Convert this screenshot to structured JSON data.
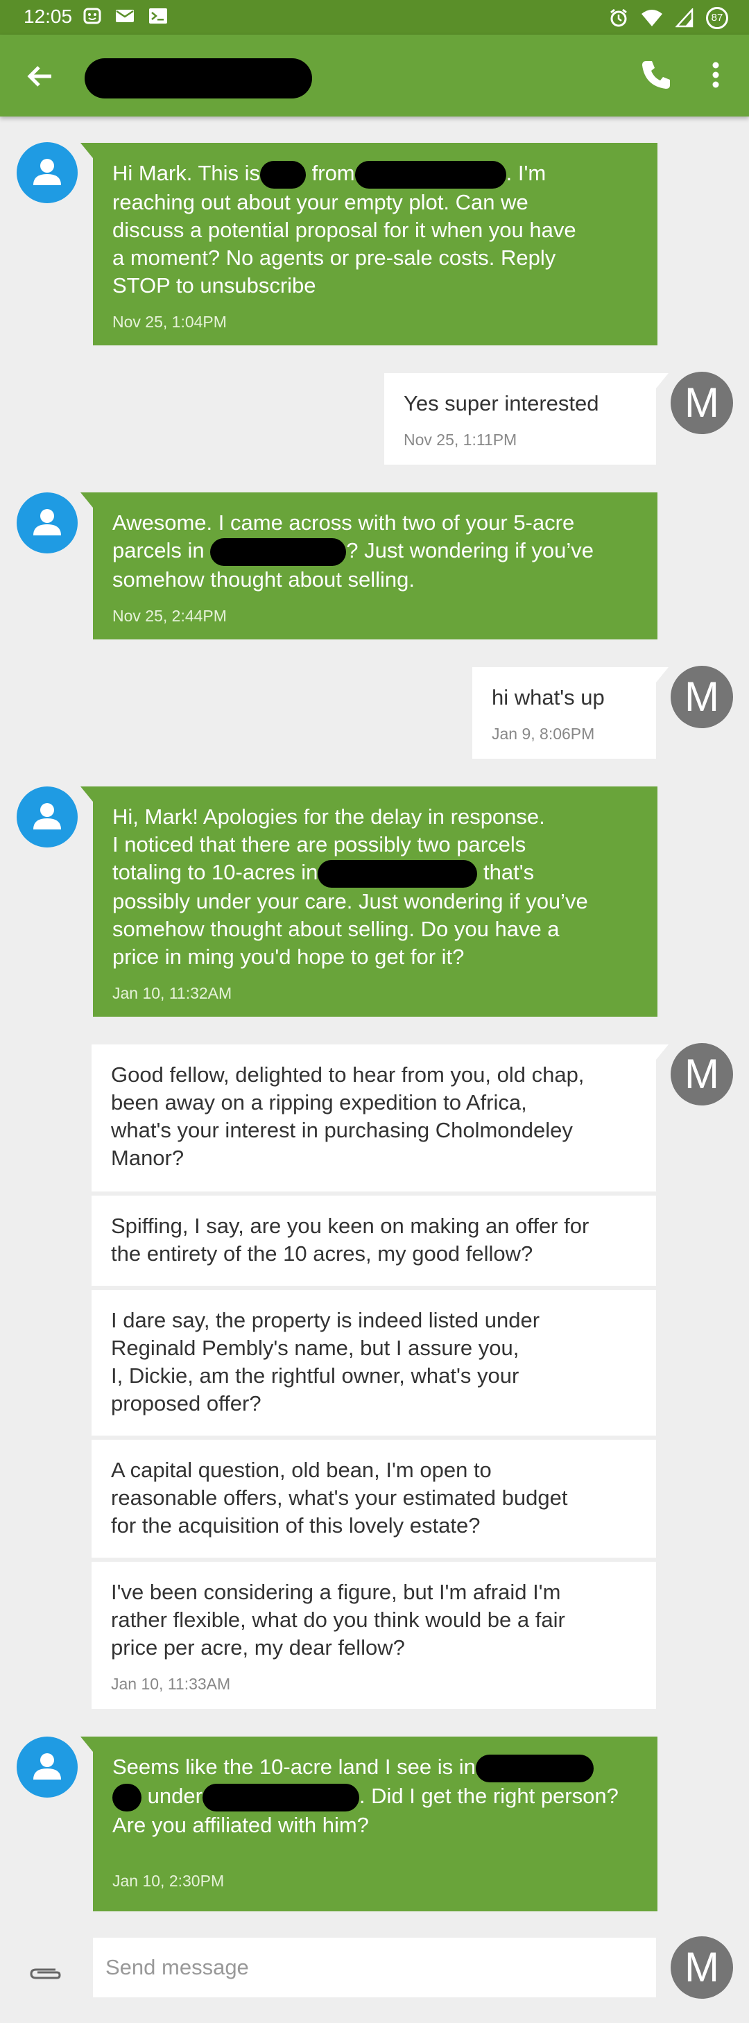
{
  "status_bar": {
    "time": "12:05",
    "battery": "87"
  },
  "app_bar": {
    "back_icon": "arrow-left-icon",
    "call_icon": "phone-icon",
    "menu_icon": "more-vert-icon"
  },
  "messages": [
    {
      "text": "Hi Mark. This is",
      "text2": " from",
      "text3": ". I'm\nreaching out about your empty plot. Can we\ndiscuss a potential proposal for it when you have\na moment? No agents or pre-sale costs.         Reply\nSTOP to unsubscribe",
      "time": "Nov 25, 1:04PM"
    },
    {
      "text": "Yes super interested",
      "time": "Nov 25, 1:11PM"
    },
    {
      "text": "Awesome. I came across with two of your 5-acre\nparcels in ",
      "text2": "? Just wondering if you’ve\nsomehow thought about selling.",
      "time": "Nov 25, 2:44PM"
    },
    {
      "text": "hi what's up",
      "time": "Jan 9, 8:06PM"
    },
    {
      "text": "Hi, Mark! Apologies for the delay in response.\nI noticed  that there are possibly two parcels\ntotaling to 10-acres in",
      "text2": " that's\npossibly under your care. Just wondering if you’ve\nsomehow thought about selling. Do you have a\nprice in ming you'd hope to get for it?",
      "time": "Jan 10, 11:32AM"
    },
    {
      "text": "Good fellow, delighted to hear from you, old chap,\nbeen away on a ripping expedition to Africa,\nwhat's your interest in purchasing Cholmondeley\nManor?"
    },
    {
      "text": "Spiffing, I say, are you keen on making an offer for\nthe entirety of the 10 acres, my good fellow?"
    },
    {
      "text": "I dare say, the property is indeed listed under\nReginald Pembly's name, but I assure you,\nI, Dickie, am the rightful owner, what's your\nproposed offer?"
    },
    {
      "text": "A capital question, old bean, I'm open to\nreasonable offers, what's your estimated budget\nfor the acquisition of this lovely estate?"
    },
    {
      "text": "I've been considering a figure, but I'm afraid I'm\nrather flexible, what do you think would be a fair\nprice per acre, my dear fellow?",
      "time": "Jan 10, 11:33AM"
    },
    {
      "text": "Seems like the 10-acre land I see is in",
      "text2": " under",
      "text3": ". Did I get the right person?\nAre you affiliated with him?",
      "time": "Jan 10, 2:30PM"
    }
  ],
  "avatar_letter": "M",
  "composer": {
    "placeholder": "Send message"
  },
  "colors": {
    "accent": "#69a43a",
    "status_bar": "#5a8f29",
    "contact_avatar": "#1f9be3",
    "user_avatar": "#757575"
  }
}
